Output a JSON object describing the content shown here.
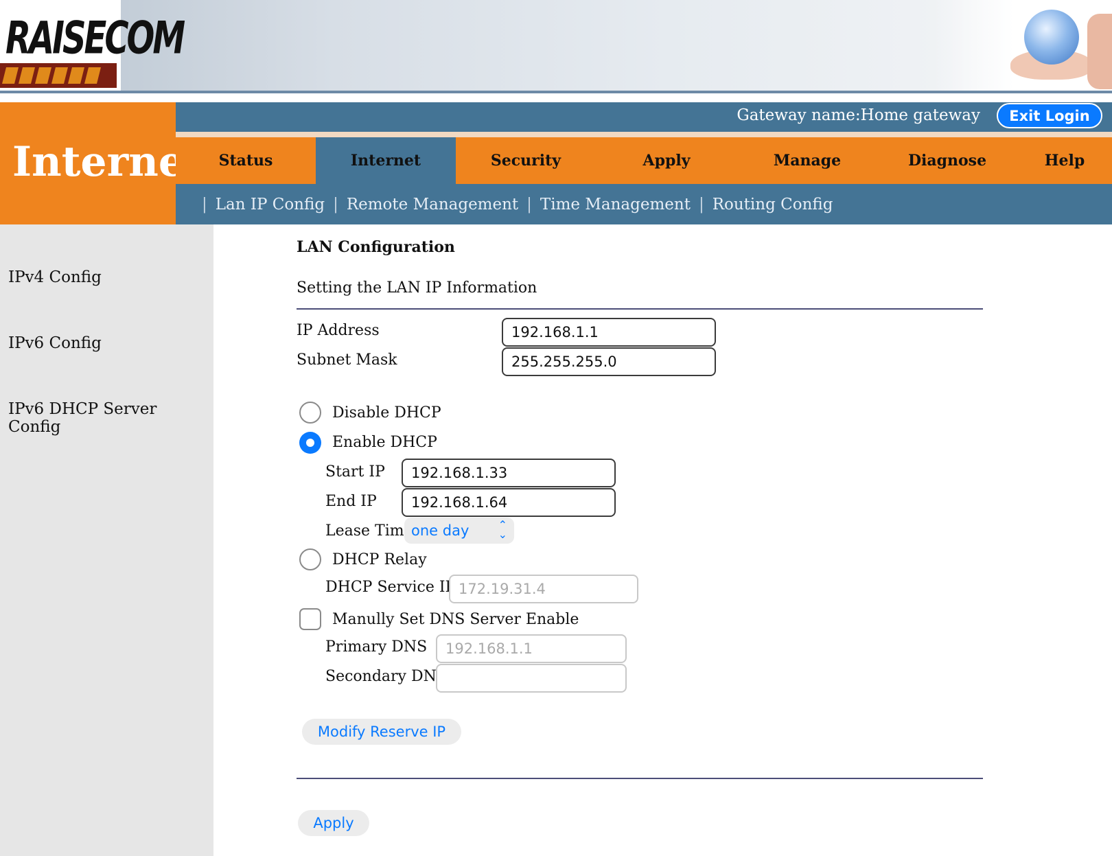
{
  "brand": {
    "logo_text": "RAISECOM"
  },
  "section": {
    "title": "Internet"
  },
  "topbar": {
    "gateway_label": "Gateway name:Home gateway",
    "exit_label": "Exit Login"
  },
  "mainnav": {
    "tabs": [
      {
        "label": "Status"
      },
      {
        "label": "Internet"
      },
      {
        "label": "Security"
      },
      {
        "label": "Apply"
      },
      {
        "label": "Manage"
      },
      {
        "label": "Diagnose"
      },
      {
        "label": "Help"
      }
    ],
    "active": "Internet"
  },
  "subnav": {
    "items": [
      {
        "label": "Lan IP Config"
      },
      {
        "label": "Remote Management"
      },
      {
        "label": "Time Management"
      },
      {
        "label": "Routing Config"
      }
    ]
  },
  "sidebar": {
    "items": [
      {
        "label": "IPv4 Config"
      },
      {
        "label": "IPv6 Config"
      },
      {
        "label": "IPv6 DHCP Server Config"
      }
    ]
  },
  "form": {
    "title": "LAN Configuration",
    "subtitle": "Setting the LAN IP Information",
    "ip_address": {
      "label": "IP Address",
      "value": "192.168.1.1"
    },
    "subnet_mask": {
      "label": "Subnet Mask",
      "value": "255.255.255.0"
    },
    "dhcp_options": {
      "disable": {
        "label": "Disable DHCP",
        "checked": false
      },
      "enable": {
        "label": "Enable DHCP",
        "checked": true
      },
      "relay": {
        "label": "DHCP Relay",
        "checked": false
      }
    },
    "start_ip": {
      "label": "Start IP",
      "value": "192.168.1.33"
    },
    "end_ip": {
      "label": "End IP",
      "value": "192.168.1.64"
    },
    "lease_time": {
      "label": "Lease Time",
      "value": "one day"
    },
    "dhcp_service_ip": {
      "label": "DHCP Service IP",
      "placeholder": "172.19.31.4"
    },
    "manual_dns": {
      "label": "Manully Set DNS Server Enable",
      "checked": false
    },
    "primary_dns": {
      "label": "Primary DNS",
      "placeholder": "192.168.1.1"
    },
    "secondary_dns": {
      "label": "Secondary DNS",
      "value": ""
    },
    "modify_button": "Modify Reserve IP",
    "apply_button": "Apply"
  },
  "colors": {
    "orange": "#ef841e",
    "steel_blue": "#447495",
    "accent_blue": "#0a7aff",
    "sidebar_bg": "#e6e6e6"
  }
}
